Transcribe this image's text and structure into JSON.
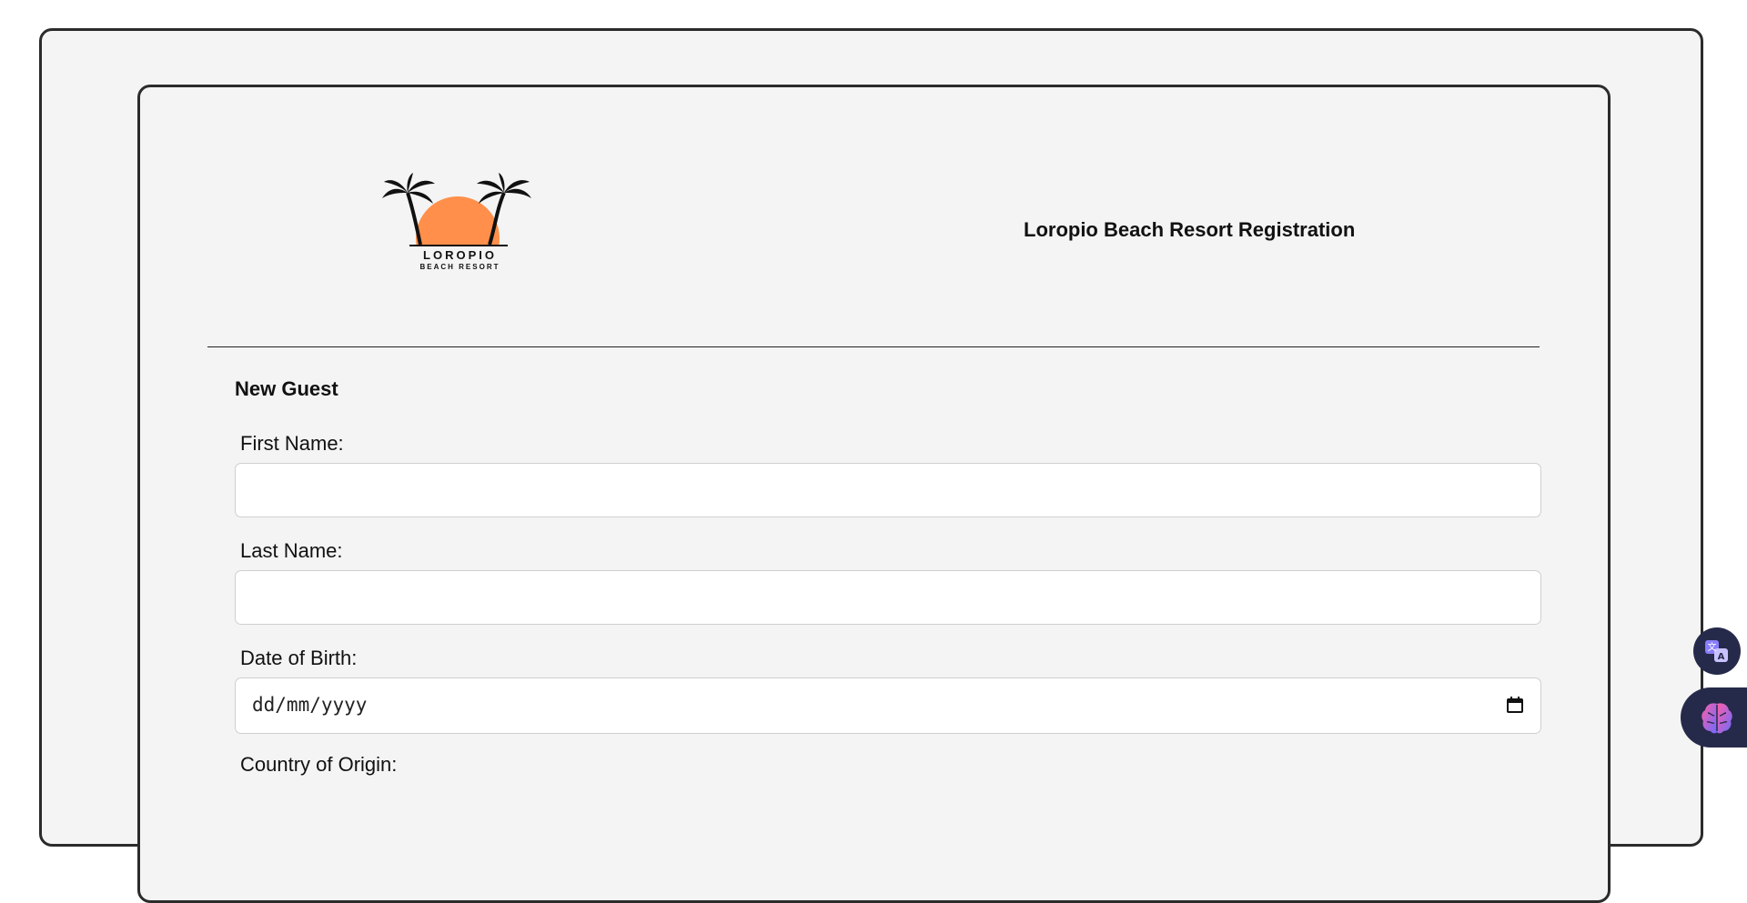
{
  "header": {
    "logo_name": "LOROPIO",
    "logo_tagline": "BEACH RESORT",
    "title": "Loropio Beach Resort Registration"
  },
  "form": {
    "section_title": "New Guest",
    "fields": [
      {
        "label": "First Name:",
        "value": ""
      },
      {
        "label": "Last Name:",
        "value": ""
      },
      {
        "label": "Date of Birth:",
        "placeholder": "dd/mm/yyyy"
      },
      {
        "label": "Country of Origin:"
      }
    ]
  },
  "icons": {
    "logo": "palm-trees-sunset-logo",
    "calendar": "calendar-icon",
    "translate": "translate-icon",
    "ai_assistant": "brain-icon"
  },
  "colors": {
    "sun": "#ff8f4a",
    "fab_bg": "#262a4a",
    "brain_gradient_start": "#ff5ea8",
    "brain_gradient_end": "#6b6bff"
  }
}
